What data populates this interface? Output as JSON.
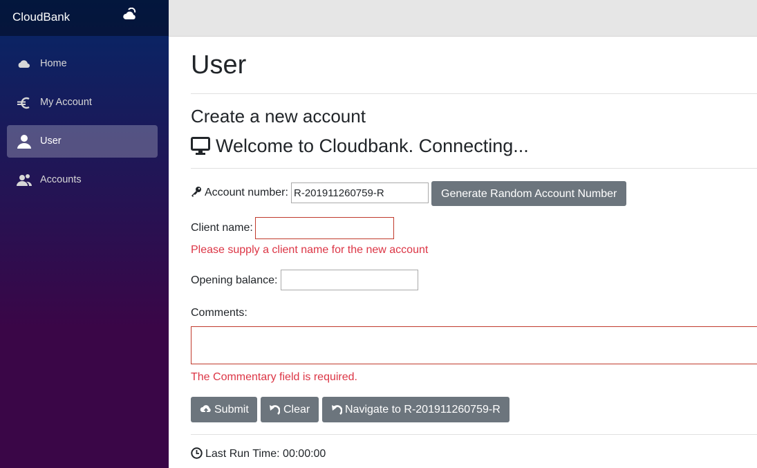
{
  "brand": {
    "name": "CloudBank",
    "icon": "cloud-sun-icon"
  },
  "sidebar": {
    "items": [
      {
        "label": "Home",
        "icon": "cloud-icon",
        "active": false
      },
      {
        "label": "My Account",
        "icon": "euro-icon",
        "active": false
      },
      {
        "label": "User",
        "icon": "person-icon",
        "active": true
      },
      {
        "label": "Accounts",
        "icon": "people-icon",
        "active": false
      }
    ]
  },
  "page": {
    "title": "User",
    "subtitle": "Create a new account",
    "welcome": "Welcome to Cloudbank. Connecting..."
  },
  "form": {
    "account_number_label": "Account number:",
    "account_number_value": "R-201911260759-R",
    "generate_button": "Generate Random Account Number",
    "client_name_label": "Client name:",
    "client_name_value": "",
    "client_name_error": "Please supply a client name for the new account",
    "opening_balance_label": "Opening balance:",
    "opening_balance_value": "",
    "comments_label": "Comments:",
    "comments_value": "",
    "comments_error": "The Commentary field is required."
  },
  "actions": {
    "submit": "Submit",
    "clear": "Clear",
    "navigate": "Navigate to R-201911260759-R"
  },
  "footer": {
    "last_run_label": "Last Run Time: 00:00:00"
  },
  "colors": {
    "sidebar_top": "#052767",
    "sidebar_bottom": "#3a0647",
    "button": "#6c757d",
    "error": "#dc3545"
  }
}
